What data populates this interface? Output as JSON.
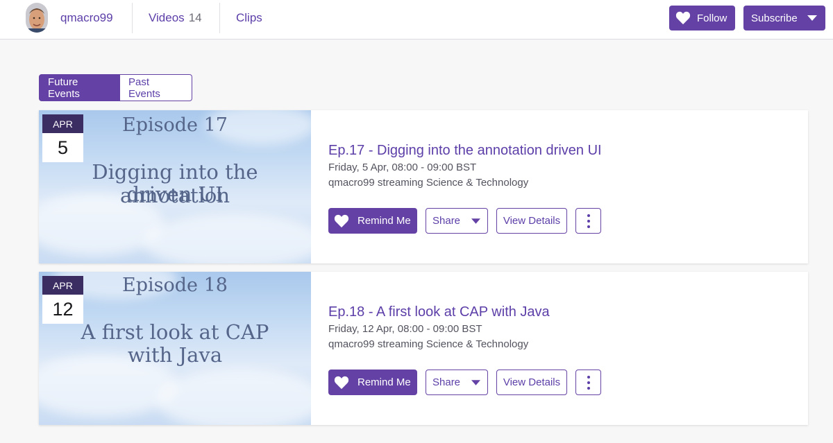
{
  "header": {
    "username": "qmacro99",
    "nav": {
      "videos_label": "Videos",
      "videos_count": "14",
      "clips_label": "Clips"
    },
    "follow_label": "Follow",
    "subscribe_label": "Subscribe"
  },
  "tabs": {
    "future": "Future Events",
    "past": "Past Events"
  },
  "events": [
    {
      "month": "APR",
      "day": "5",
      "thumb_episode": "Episode 17",
      "thumb_title_line1": "Digging into the annotation",
      "thumb_title_line2": "driven UI",
      "title": "Ep.17 - Digging into the annotation driven UI",
      "datetime": "Friday, 5 Apr, 08:00 - 09:00 BST",
      "category": "qmacro99 streaming Science & Technology",
      "remind_label": "Remind Me",
      "share_label": "Share",
      "details_label": "View Details"
    },
    {
      "month": "APR",
      "day": "12",
      "thumb_episode": "Episode 18",
      "thumb_title_line1": "A first look at CAP",
      "thumb_title_line2": "with Java",
      "title": "Ep.18 - A first look at CAP with Java",
      "datetime": "Friday, 12 Apr, 08:00 - 09:00 BST",
      "category": "qmacro99 streaming Science & Technology",
      "remind_label": "Remind Me",
      "share_label": "Share",
      "details_label": "View Details"
    }
  ],
  "colors": {
    "brand_purple": "#6441a4",
    "date_header": "#3b2c62",
    "link_purple": "#5c3ea8"
  }
}
